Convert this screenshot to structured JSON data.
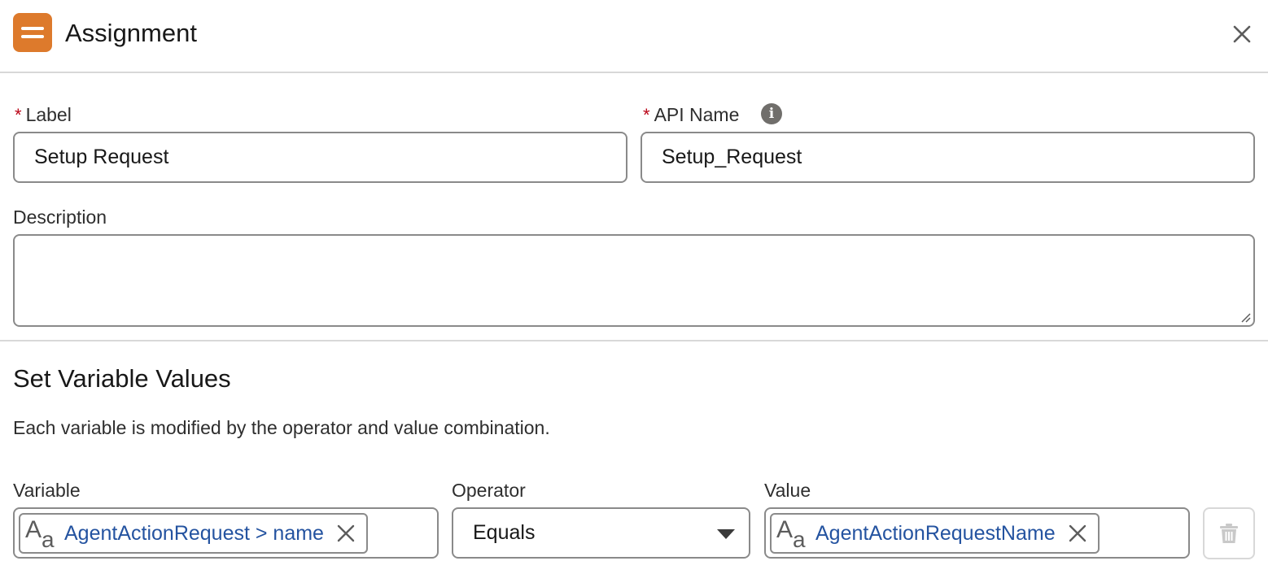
{
  "header": {
    "title": "Assignment",
    "icon": "assignment-icon",
    "icon_color": "#dd7a2c"
  },
  "fields": {
    "label": {
      "label": "Label",
      "required_mark": "*",
      "value": "Setup Request"
    },
    "api_name": {
      "label": "API Name",
      "required_mark": "*",
      "value": "Setup_Request",
      "info_icon": "i"
    },
    "description": {
      "label": "Description",
      "value": ""
    }
  },
  "section": {
    "title": "Set Variable Values",
    "description": "Each variable is modified by the operator and value combination."
  },
  "assignment_row": {
    "variable": {
      "label": "Variable",
      "pill_text": "AgentActionRequest > name",
      "type_icon": "text-type-icon"
    },
    "operator": {
      "label": "Operator",
      "value": "Equals"
    },
    "value": {
      "label": "Value",
      "pill_text": "AgentActionRequestName",
      "type_icon": "text-type-icon"
    },
    "delete_icon": "trash-icon"
  },
  "colors": {
    "required": "#ba0517",
    "link": "#2453a0",
    "border": "#8a8a8a"
  }
}
